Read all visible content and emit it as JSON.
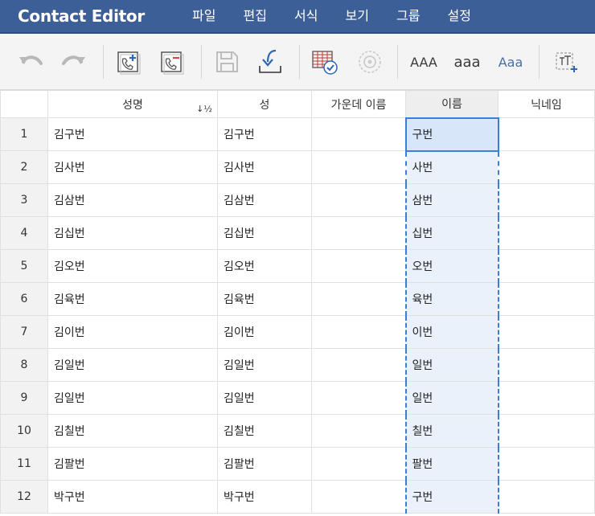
{
  "app": {
    "title": "Contact Editor"
  },
  "menu": [
    "파일",
    "편집",
    "서식",
    "보기",
    "그룹",
    "설정"
  ],
  "toolbar": {
    "case_upper": "AAA",
    "case_lower": "aaa",
    "case_title": "Aaa"
  },
  "table": {
    "columns": [
      "",
      "성명",
      "성",
      "가운데 이름",
      "이름",
      "닉네임"
    ],
    "sort_indicator": "↓½",
    "rows": [
      {
        "num": "1",
        "full": "김구번",
        "last": "김구번",
        "middle": "",
        "first": "구번",
        "nick": ""
      },
      {
        "num": "2",
        "full": "김사번",
        "last": "김사번",
        "middle": "",
        "first": "사번",
        "nick": ""
      },
      {
        "num": "3",
        "full": "김삼번",
        "last": "김삼번",
        "middle": "",
        "first": "삼번",
        "nick": ""
      },
      {
        "num": "4",
        "full": "김십번",
        "last": "김십번",
        "middle": "",
        "first": "십번",
        "nick": ""
      },
      {
        "num": "5",
        "full": "김오번",
        "last": "김오번",
        "middle": "",
        "first": "오번",
        "nick": ""
      },
      {
        "num": "6",
        "full": "김육번",
        "last": "김육번",
        "middle": "",
        "first": "육번",
        "nick": ""
      },
      {
        "num": "7",
        "full": "김이번",
        "last": "김이번",
        "middle": "",
        "first": "이번",
        "nick": ""
      },
      {
        "num": "8",
        "full": "김일번",
        "last": "김일번",
        "middle": "",
        "first": "일번",
        "nick": ""
      },
      {
        "num": "9",
        "full": "김일번",
        "last": "김일번",
        "middle": "",
        "first": "일번",
        "nick": ""
      },
      {
        "num": "10",
        "full": "김칠번",
        "last": "김칠번",
        "middle": "",
        "first": "칠번",
        "nick": ""
      },
      {
        "num": "11",
        "full": "김팔번",
        "last": "김팔번",
        "middle": "",
        "first": "팔번",
        "nick": ""
      },
      {
        "num": "12",
        "full": "박구번",
        "last": "박구번",
        "middle": "",
        "first": "구번",
        "nick": ""
      }
    ]
  },
  "colors": {
    "titlebar": "#3d5f97",
    "selection": "#3b7dd8",
    "icon_blue": "#2f66b3",
    "icon_red": "#d9473f"
  }
}
